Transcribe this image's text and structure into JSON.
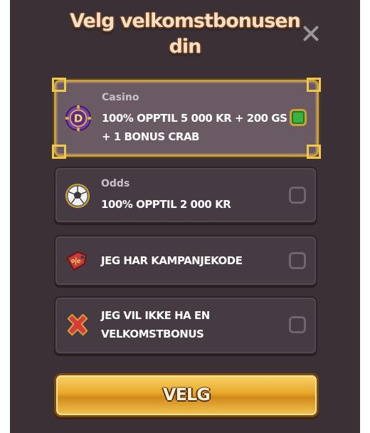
{
  "dialog": {
    "title_line1": "Velg velkomstbonusen",
    "title_line2": "din"
  },
  "options": [
    {
      "category": "Casino",
      "line1": "100% OPPTIL 5 000 KR + 200 GS",
      "line2": "+ 1 BONUS CRAB",
      "icon": "casino-chip-icon",
      "selected": true
    },
    {
      "category": "Odds",
      "line1": "100% OPPTIL 2 000 KR",
      "icon": "soccer-ball-icon",
      "selected": false
    },
    {
      "line1": "JEG HAR KAMPANJEKODE",
      "icon": "promo-tag-icon",
      "selected": false
    },
    {
      "line1": "JEG VIL IKKE HA EN",
      "line2": "VELKOMSTBONUS",
      "icon": "red-x-icon",
      "selected": false
    }
  ],
  "cta": {
    "label": "VELG"
  },
  "colors": {
    "background": "#3a3036",
    "accent_gold": "#c9a136",
    "checkbox_checked": "#3cb043"
  }
}
